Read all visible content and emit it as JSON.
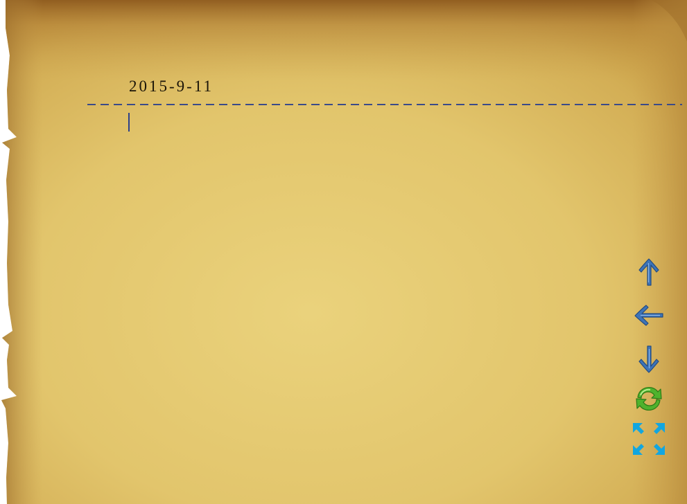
{
  "note": {
    "date": "2015-9-11",
    "body": ""
  },
  "toolbar": {
    "buttons": [
      {
        "id": "up",
        "icon": "arrow-up-icon"
      },
      {
        "id": "back",
        "icon": "arrow-left-icon"
      },
      {
        "id": "down",
        "icon": "arrow-down-icon"
      },
      {
        "id": "refresh",
        "icon": "refresh-icon"
      },
      {
        "id": "fullscreen",
        "icon": "fullscreen-icon"
      }
    ]
  },
  "colors": {
    "parchment_center": "#e8cf79",
    "parchment_edge": "#b98a3a",
    "date_text": "#1a1408",
    "rule_line": "#3a4a8a",
    "arrow_blue": "#3d74b8",
    "refresh_green": "#4fb22d",
    "fullscreen_cyan": "#12a6e0"
  }
}
